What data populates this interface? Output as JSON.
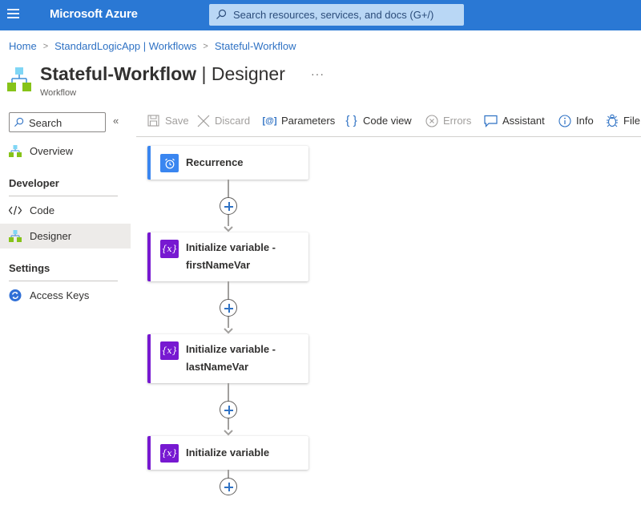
{
  "topbar": {
    "menu_icon": "hamburger-icon",
    "brand": "Microsoft Azure",
    "search_placeholder": "Search resources, services, and docs (G+/)",
    "search_icon": "search-icon"
  },
  "breadcrumb": [
    {
      "label": "Home"
    },
    {
      "label": "StandardLogicApp | Workflows"
    },
    {
      "label": "Stateful-Workflow"
    }
  ],
  "header": {
    "title_bold": "Stateful-Workflow",
    "title_rest": " | Designer",
    "more": "···",
    "subtitle": "Workflow",
    "icon": "workflow-icon"
  },
  "sidebar": {
    "search_placeholder": "Search",
    "collapse": "«",
    "items": [
      {
        "label": "Overview",
        "icon": "workflow-icon"
      },
      {
        "section": "Developer"
      },
      {
        "label": "Code",
        "icon": "code-icon"
      },
      {
        "label": "Designer",
        "icon": "workflow-icon",
        "active": true
      },
      {
        "section": "Settings"
      },
      {
        "label": "Access Keys",
        "icon": "refresh-key-icon"
      }
    ],
    "sections": {
      "developer": "Developer",
      "settings": "Settings"
    },
    "overview": "Overview",
    "code": "Code",
    "designer": "Designer",
    "access_keys": "Access Keys"
  },
  "toolbar": {
    "save": "Save",
    "discard": "Discard",
    "parameters": "Parameters",
    "code_view": "Code view",
    "errors": "Errors",
    "assistant": "Assistant",
    "info": "Info",
    "file": "File"
  },
  "workflow": {
    "steps": [
      {
        "line1": "Recurrence",
        "line2": "",
        "type": "trigger",
        "color": "#3a86f0",
        "icon": "alarm-clock-icon"
      },
      {
        "line1": "Initialize variable -",
        "line2": "firstNameVar",
        "type": "action",
        "color": "#7719d1",
        "icon": "variable-icon"
      },
      {
        "line1": "Initialize variable -",
        "line2": "lastNameVar",
        "type": "action",
        "color": "#7719d1",
        "icon": "variable-icon"
      },
      {
        "line1": "Initialize variable",
        "line2": "",
        "type": "action",
        "color": "#7719d1",
        "icon": "variable-icon"
      }
    ]
  },
  "colors": {
    "topbar": "#2a78d4",
    "link": "#2f72c4",
    "trigger_accent": "#3a86f0",
    "variable_accent": "#7719d1"
  }
}
